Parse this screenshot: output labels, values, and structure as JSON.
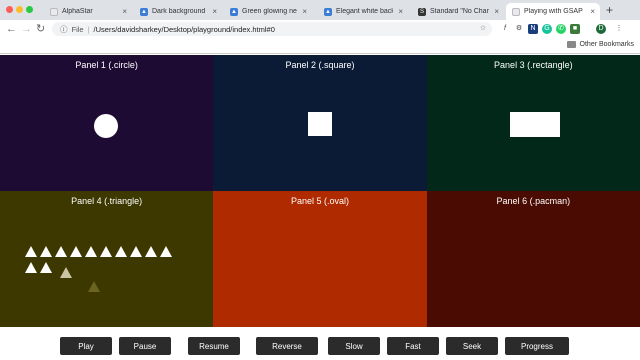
{
  "browser": {
    "tabs": [
      {
        "label": "AlphaStar",
        "favicon": "page-icon",
        "favicon_color": "#e8eaed"
      },
      {
        "label": "Dark background Vect",
        "favicon": "vecteezy-icon",
        "favicon_color": "#3b7cd6"
      },
      {
        "label": "Green glowing neon b",
        "favicon": "vecteezy-icon",
        "favicon_color": "#3b7cd6"
      },
      {
        "label": "Elegant white backgr",
        "favicon": "vecteezy-icon",
        "favicon_color": "#3b7cd6"
      },
      {
        "label": "Standard \"No Charge",
        "favicon": "shutterstock-icon",
        "favicon_color": "#333333"
      },
      {
        "label": "Playing with GSAP",
        "favicon": "page-icon",
        "favicon_color": "#e8eaed"
      }
    ],
    "address": {
      "scheme_label": "File",
      "url": "/Users/davidsharkey/Desktop/playground/index.html#0"
    },
    "profile_initial": "D",
    "bookmarks": {
      "other_label": "Other Bookmarks"
    }
  },
  "panels": [
    {
      "title": "Panel 1 (.circle)",
      "color": "#1e0b33",
      "shape": "circle"
    },
    {
      "title": "Panel 2 (.square)",
      "color": "#0c1b35",
      "shape": "square"
    },
    {
      "title": "Panel 3 (.rectangle)",
      "color": "#02281a",
      "shape": "rectangle"
    },
    {
      "title": "Panel 4 (.triangle)",
      "color": "#3d3700",
      "shape": "triangle"
    },
    {
      "title": "Panel 5 (.oval)",
      "color": "#b02a00",
      "shape": "oval"
    },
    {
      "title": "Panel 6 (.pacman)",
      "color": "#4a0c02",
      "shape": "pacman"
    }
  ],
  "controls": {
    "buttons": [
      "Play",
      "Pause",
      "Resume",
      "Reverse",
      "Slow",
      "Fast",
      "Seek",
      "Progress"
    ]
  }
}
